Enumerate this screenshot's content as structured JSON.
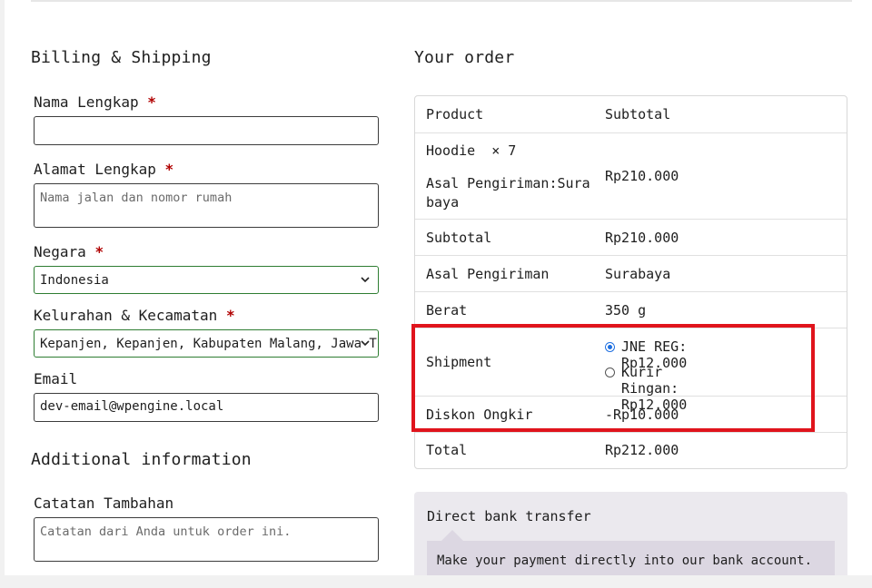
{
  "billing": {
    "title": "Billing & Shipping",
    "name_label": "Nama Lengkap",
    "name_value": "",
    "address_label": "Alamat Lengkap",
    "address_placeholder": "Nama jalan dan nomor rumah",
    "country_label": "Negara",
    "country_value": "Indonesia",
    "district_label": "Kelurahan & Kecamatan",
    "district_value": "Kepanjen, Kepanjen, Kabupaten Malang, Jawa Timur",
    "email_label": "Email",
    "email_value": "dev-email@wpengine.local",
    "required_mark": "*"
  },
  "additional": {
    "title": "Additional information",
    "notes_label": "Catatan Tambahan",
    "notes_placeholder": "Catatan dari Anda untuk order ini."
  },
  "order": {
    "title": "Your order",
    "header_product": "Product",
    "header_subtotal": "Subtotal",
    "item_name": "Hoodie",
    "item_qty": "× 7",
    "item_origin_label": "Asal Pengiriman:",
    "item_origin_value_line1": "Sura",
    "item_origin_value_line2": "baya",
    "item_price": "Rp210.000",
    "subtotal_label": "Subtotal",
    "subtotal_value": "Rp210.000",
    "origin_label": "Asal Pengiriman",
    "origin_value": "Surabaya",
    "weight_label": "Berat",
    "weight_value": "350 g",
    "shipment_label": "Shipment",
    "shipment_options": [
      {
        "label": "JNE REG: Rp12.000",
        "selected": true
      },
      {
        "label": "Kurir Ringan: Rp12.000",
        "selected": false
      }
    ],
    "discount_label": "Diskon Ongkir",
    "discount_value": "-Rp10.000",
    "total_label": "Total",
    "total_value": "Rp212.000"
  },
  "payment": {
    "method_label": "Direct bank transfer",
    "description": "Make your payment directly into our bank account."
  },
  "colors": {
    "highlight": "#e0141c",
    "select_border": "#2e7d32",
    "required": "#b00000",
    "radio_selected": "#1e6fe0"
  }
}
